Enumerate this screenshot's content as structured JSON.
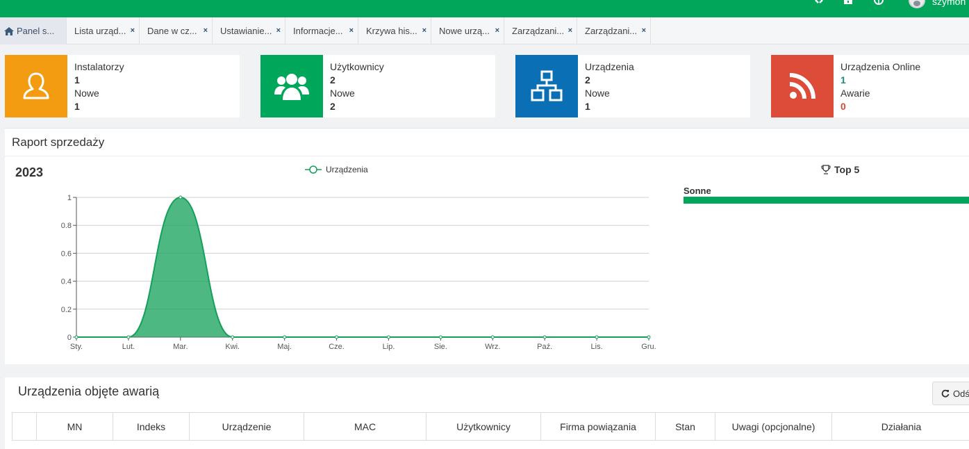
{
  "header": {
    "username": "szymon",
    "icons": [
      "expand-icon",
      "briefcase-icon",
      "globe-icon",
      "user-avatar"
    ]
  },
  "tabs": [
    {
      "label": "Panel s...",
      "icon": "home-icon",
      "active": true
    },
    {
      "label": "Lista urząd..."
    },
    {
      "label": "Dane w cz..."
    },
    {
      "label": "Ustawianie..."
    },
    {
      "label": "Informacje..."
    },
    {
      "label": "Krzywa his..."
    },
    {
      "label": "Nowe urzą..."
    },
    {
      "label": "Zarządzani..."
    },
    {
      "label": "Zarządzani..."
    }
  ],
  "tab_close_glyph": "×",
  "stats": [
    {
      "title": "Instalatorzy",
      "value": "1",
      "sub_label": "Nowe",
      "sub_value": "1",
      "color": "#f39c12",
      "icon": "user-outline-icon"
    },
    {
      "title": "Użytkownicy",
      "value": "2",
      "sub_label": "Nowe",
      "sub_value": "2",
      "color": "#00a65a",
      "icon": "users-icon"
    },
    {
      "title": "Urządzenia",
      "value": "2",
      "sub_label": "Nowe",
      "sub_value": "1",
      "color": "#0b6fb6",
      "icon": "sitemap-icon"
    },
    {
      "title": "Urządzenia Online",
      "value": "1",
      "sub_label": "Awarie",
      "sub_value": "0",
      "color": "#dd4b39",
      "icon": "rss-icon"
    }
  ],
  "sales": {
    "title": "Raport sprzedaży",
    "year": "2023",
    "top_title": "Top 5",
    "top_items": [
      {
        "name": "Sonne",
        "fraction": 1.0
      }
    ]
  },
  "chart_data": {
    "type": "area",
    "categories": [
      "Sty.",
      "Lut.",
      "Mar.",
      "Kwi.",
      "Maj.",
      "Cze.",
      "Lip.",
      "Sie.",
      "Wrz.",
      "Paź.",
      "Lis.",
      "Gru."
    ],
    "series": [
      {
        "name": "Urządzenia",
        "values": [
          0,
          0,
          1,
          0,
          0,
          0,
          0,
          0,
          0,
          0,
          0,
          0
        ],
        "color": "#13a05a"
      }
    ],
    "ylim": [
      0,
      1
    ],
    "yticks": [
      "0",
      "0.2",
      "0.4",
      "0.6",
      "0.8",
      "1"
    ],
    "grid": true,
    "legend": "top"
  },
  "failures": {
    "title": "Urządzenia objęte awarią",
    "refresh_label": "Odś",
    "columns": [
      "",
      "MN",
      "Indeks",
      "Urządzenie",
      "MAC",
      "Użytkownicy",
      "Firma powiązania",
      "Stan",
      "Uwagi (opcjonalne)",
      "Działania"
    ]
  }
}
